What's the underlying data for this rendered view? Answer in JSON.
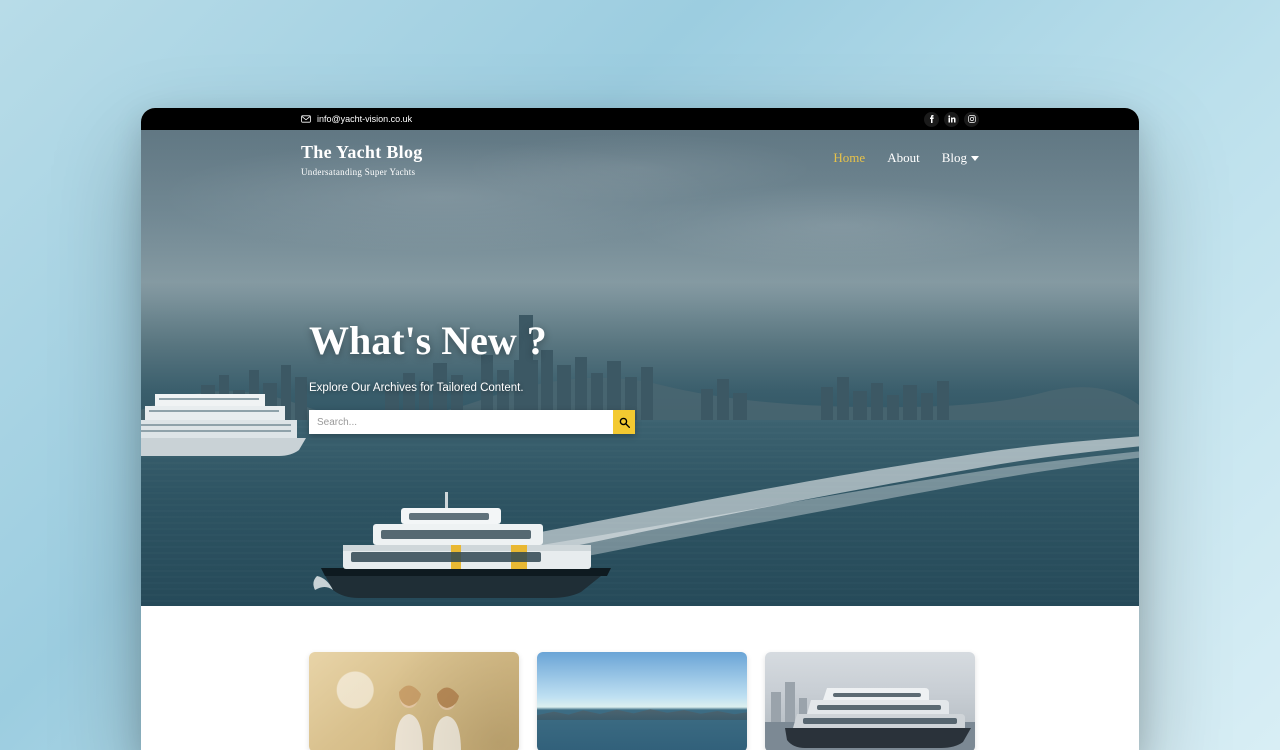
{
  "topbar": {
    "email": "info@yacht-vision.co.uk"
  },
  "brand": {
    "title": "The Yacht Blog",
    "subtitle": "Undersatanding Super Yachts"
  },
  "menu": {
    "home": "Home",
    "about": "About",
    "blog": "Blog"
  },
  "hero": {
    "title": "What's New ?",
    "subtitle": "Explore Our Archives for Tailored Content.",
    "search_placeholder": "Search..."
  }
}
